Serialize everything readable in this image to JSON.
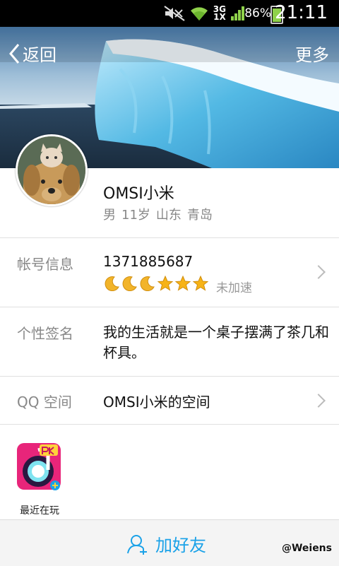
{
  "status_bar": {
    "network_top": "3G",
    "network_bottom": "1X",
    "battery_percent": "86%",
    "time": "21:11",
    "icons": [
      "mute-icon",
      "wifi-icon",
      "signal-icon",
      "battery-icon"
    ]
  },
  "header": {
    "back_label": "返回",
    "more_label": "更多"
  },
  "profile": {
    "nickname": "OMSI小米",
    "gender": "男",
    "age": "11岁",
    "province": "山东",
    "city": "青岛"
  },
  "account": {
    "label": "帐号信息",
    "number": "1371885687",
    "level_icons": [
      "moon",
      "moon",
      "moon",
      "star",
      "star",
      "star"
    ],
    "accel_status": "未加速"
  },
  "signature": {
    "label": "个性签名",
    "text": "我的生活就是一个桌子摆满了茶几和杯具。"
  },
  "qzone": {
    "label": "QQ 空间",
    "value": "OMSI小米的空间"
  },
  "recent": {
    "label": "最近在玩"
  },
  "bottom": {
    "add_friend_label": "加好友"
  },
  "watermark": "@Weiens",
  "colors": {
    "accent": "#1ba2e8",
    "star": "#f7b316",
    "moon": "#f2b42a"
  }
}
